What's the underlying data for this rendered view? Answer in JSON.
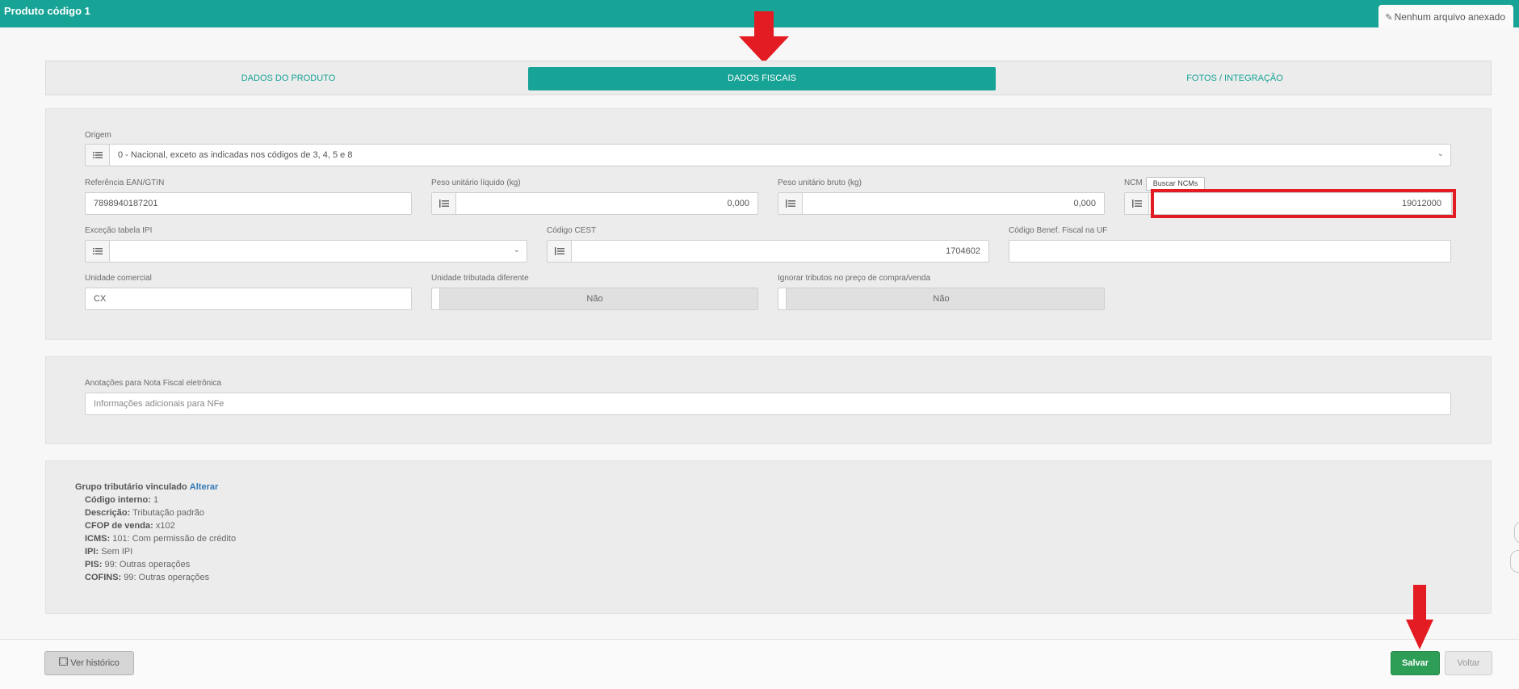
{
  "header": {
    "title": "Produto código 1",
    "attachment_label": "Nenhum arquivo anexado"
  },
  "tabs": [
    {
      "label": "DADOS DO PRODUTO",
      "active": false
    },
    {
      "label": "DADOS FISCAIS",
      "active": true
    },
    {
      "label": "FOTOS / INTEGRAÇÃO",
      "active": false
    }
  ],
  "fiscal": {
    "origem_label": "Origem",
    "origem_value": "0 - Nacional, exceto as indicadas nos códigos de 3, 4, 5 e 8",
    "ean_label": "Referência EAN/GTIN",
    "ean_value": "7898940187201",
    "peso_liquido_label": "Peso unitário líquido (kg)",
    "peso_liquido_value": "0,000",
    "peso_bruto_label": "Peso unitário bruto (kg)",
    "peso_bruto_value": "0,000",
    "ncm_label": "NCM",
    "ncm_button": "Buscar NCMs",
    "ncm_value": "19012000",
    "excecao_ipi_label": "Exceção tabela IPI",
    "excecao_ipi_value": "",
    "cest_label": "Código CEST",
    "cest_value": "1704602",
    "benef_label": "Código Benef. Fiscal na UF",
    "benef_value": "",
    "unidade_comercial_label": "Unidade comercial",
    "unidade_comercial_value": "CX",
    "unidade_tributada_label": "Unidade tributada diferente",
    "unidade_tributada_value": "Não",
    "ignorar_tributos_label": "Ignorar tributos no preço de compra/venda",
    "ignorar_tributos_value": "Não"
  },
  "nfe": {
    "label": "Anotações para Nota Fiscal eletrônica",
    "placeholder": "Informações adicionais para NFe"
  },
  "grupo": {
    "title": "Grupo tributário vinculado",
    "change_link": "Alterar",
    "rows": [
      {
        "key": "Código interno:",
        "value": "1"
      },
      {
        "key": "Descrição:",
        "value": "Tributação padrão"
      },
      {
        "key": "CFOP de venda:",
        "value": "x102"
      },
      {
        "key": "ICMS:",
        "value": "101: Com permissão de crédito"
      },
      {
        "key": "IPI:",
        "value": "Sem IPI"
      },
      {
        "key": "PIS:",
        "value": "99: Outras operações"
      },
      {
        "key": "COFINS:",
        "value": "99: Outras operações"
      }
    ]
  },
  "footer": {
    "history_button": "Ver histórico",
    "save_button": "Salvar",
    "back_button": "Voltar"
  },
  "colors": {
    "accent": "#17a396",
    "save": "#2e9e56",
    "annotation": "#e31b23"
  }
}
